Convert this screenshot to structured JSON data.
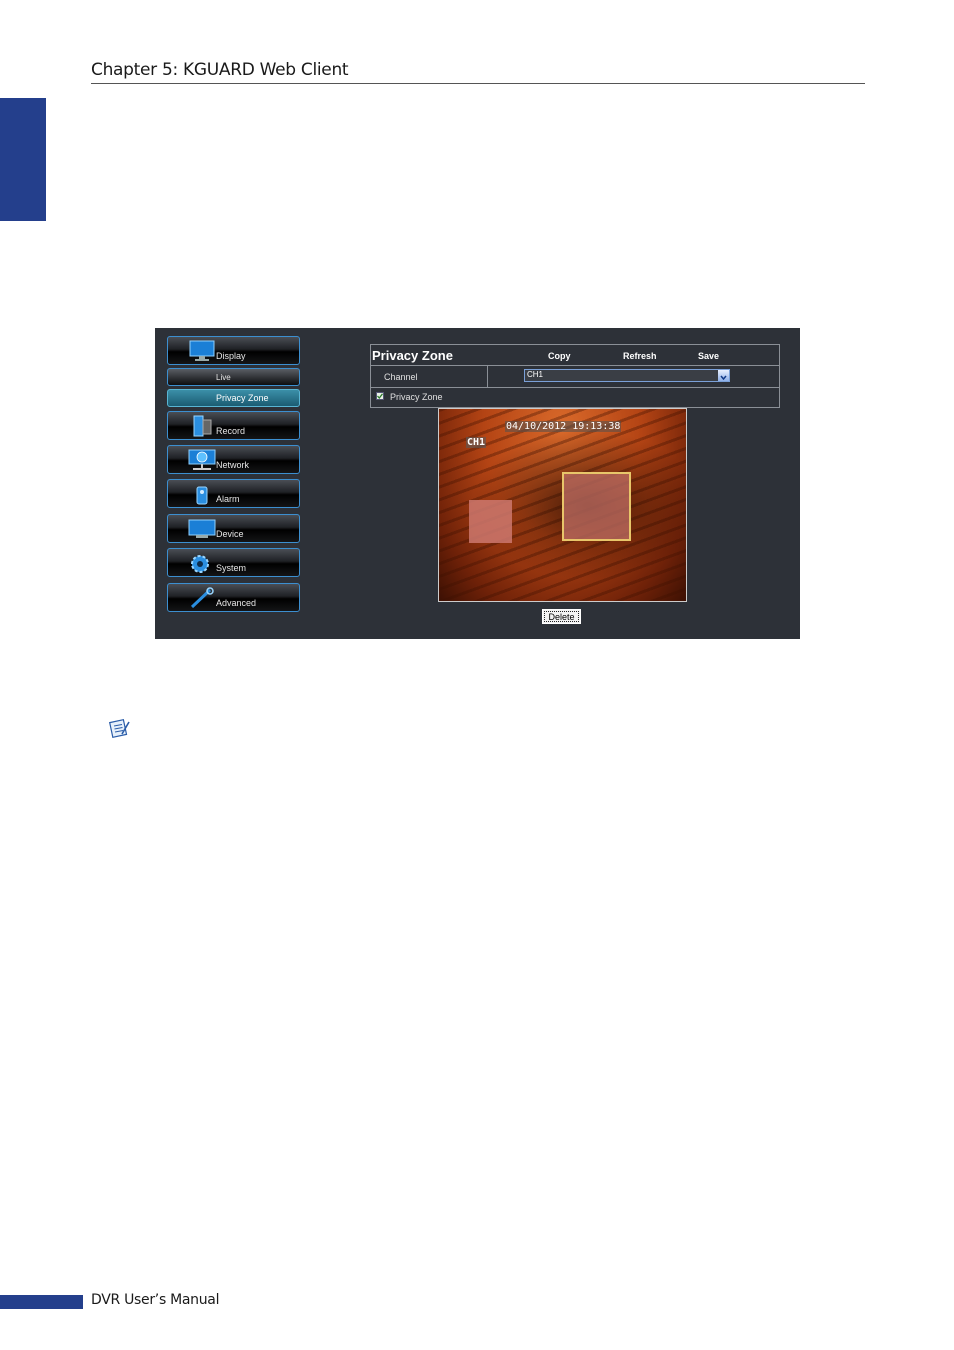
{
  "page": {
    "chapter_title": "Chapter 5: KGUARD Web Client",
    "footer_text": "DVR User’s Manual"
  },
  "colors": {
    "accent_blue": "#243f8c",
    "screen_bg": "#2d3138",
    "nav_border": "#3c8fd0"
  },
  "screenshot": {
    "nav": {
      "display": "Display",
      "live": "Live",
      "privacy_zone": "Privacy Zone",
      "record": "Record",
      "network": "Network",
      "alarm": "Alarm",
      "device": "Device",
      "system": "System",
      "advanced": "Advanced"
    },
    "panel": {
      "title": "Privacy Zone",
      "copy": "Copy",
      "refresh": "Refresh",
      "save": "Save",
      "channel_label": "Channel",
      "channel_value": "CH1",
      "privacy_zone_checkbox_label": "Privacy Zone",
      "privacy_zone_checked": true
    },
    "video": {
      "timestamp": "04/10/2012  19:13:38",
      "channel": "CH1"
    },
    "delete_label": "Delete"
  },
  "icons": [
    "note-icon",
    "monitor-icon",
    "record-icon",
    "network-icon",
    "alarm-icon",
    "device-icon",
    "gear-icon",
    "wrench-icon",
    "dropdown-arrow-icon",
    "checkbox-checked-icon"
  ]
}
